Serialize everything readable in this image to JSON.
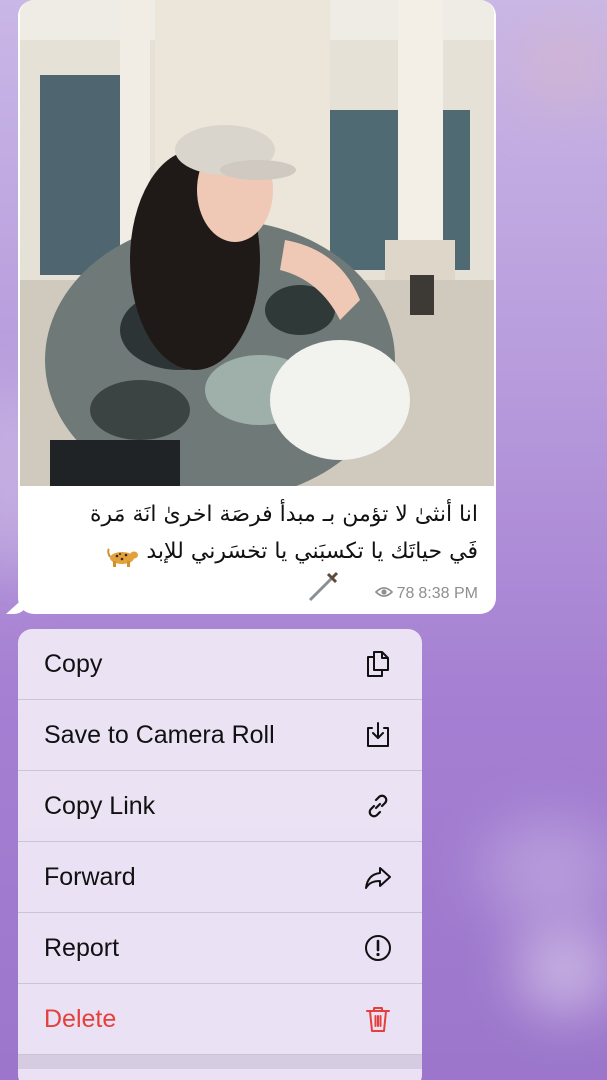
{
  "message": {
    "caption_line1": "انا أنثىٰ لا تؤمن بـ مبدأ فرصَة اخرىٰ انَة مَرة",
    "caption_line2": "فَي حياتَك يا تكسبَني يا تخسَرني للإبد",
    "views": "78",
    "time": "8:38 PM",
    "photo_icon": "photo-of-woman-icon",
    "leopard_icon": "leopard-emoji-icon",
    "dagger_icon": "dagger-emoji-icon",
    "views_icon": "eye-icon"
  },
  "context_menu": {
    "items": [
      {
        "label": "Copy",
        "icon": "copy-icon",
        "destructive": false
      },
      {
        "label": "Save to Camera Roll",
        "icon": "download-icon",
        "destructive": false
      },
      {
        "label": "Copy Link",
        "icon": "link-icon",
        "destructive": false
      },
      {
        "label": "Forward",
        "icon": "forward-icon",
        "destructive": false
      },
      {
        "label": "Report",
        "icon": "exclamation-circle-icon",
        "destructive": false
      },
      {
        "label": "Delete",
        "icon": "trash-icon",
        "destructive": true
      }
    ]
  },
  "colors": {
    "background_top": "#c9b7e6",
    "background_bottom": "#9b76cb",
    "destructive": "#e5413b",
    "meta_text": "#8e8e93"
  }
}
